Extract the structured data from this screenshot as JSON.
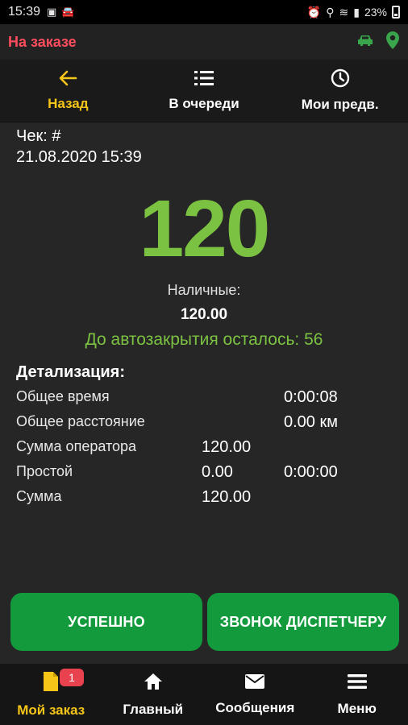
{
  "status_bar": {
    "time": "15:39",
    "battery": "23%"
  },
  "state": {
    "label": "На заказе",
    "icons": [
      "car-icon",
      "location-pin-icon"
    ],
    "accent": "#ff4d5e",
    "icon_color": "#3aa64b"
  },
  "top_nav": {
    "back": {
      "label": "Назад",
      "icon": "arrow-left-icon"
    },
    "queue": {
      "label": "В очереди",
      "icon": "list-icon"
    },
    "presets": {
      "label": "Мои предв.",
      "icon": "clock-icon"
    }
  },
  "receipt": {
    "check_label": "Чек: #",
    "datetime": "21.08.2020 15:39",
    "amount": "120",
    "payment_label": "Наличные:",
    "payment_value": "120.00",
    "autoclose": "До автозакрытия осталось: 56"
  },
  "details": {
    "title": "Детализация:",
    "rows": [
      {
        "name": "Общее время",
        "v1": "",
        "v2": "0:00:08"
      },
      {
        "name": "Общее расстояние",
        "v1": "",
        "v2": "0.00 км"
      },
      {
        "name": "Сумма оператора",
        "v1": "120.00",
        "v2": ""
      },
      {
        "name": "Простой",
        "v1": "0.00",
        "v2": "0:00:00"
      },
      {
        "name": "Сумма",
        "v1": "120.00",
        "v2": ""
      }
    ]
  },
  "actions": {
    "success": "УСПЕШНО",
    "call_dispatcher": "ЗВОНОК ДИСПЕТЧЕРУ"
  },
  "bottom_nav": {
    "my_order": {
      "label": "Мой заказ",
      "badge": "1"
    },
    "main": {
      "label": "Главный"
    },
    "messages": {
      "label": "Сообщения"
    },
    "menu": {
      "label": "Меню"
    }
  },
  "colors": {
    "accent_yellow": "#f5c518",
    "accent_green": "#7cc242",
    "button_green": "#139a3d"
  }
}
